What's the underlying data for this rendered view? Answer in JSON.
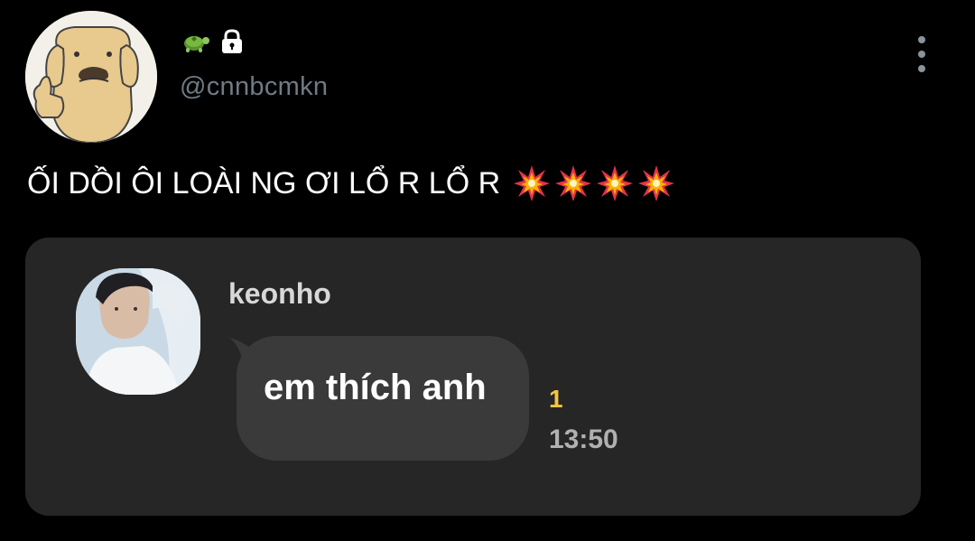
{
  "profile": {
    "display_emoji_icons": [
      "turtle-icon",
      "lock-icon"
    ],
    "handle": "@cnnbcmkn"
  },
  "tweet": {
    "text": "ỐI DỒI ÔI LOÀI NG ƠI LỔ R LỔ R",
    "emoji_icons": [
      "collision-icon",
      "collision-icon",
      "collision-icon",
      "collision-icon"
    ]
  },
  "chat_screenshot": {
    "sender": "keonho",
    "message": "em thích anh",
    "unread_count": "1",
    "time": "13:50"
  },
  "colors": {
    "background": "#000000",
    "card": "#262626",
    "bubble": "#3a3a3a",
    "handle": "#6f7b85",
    "unread": "#f5c542"
  }
}
